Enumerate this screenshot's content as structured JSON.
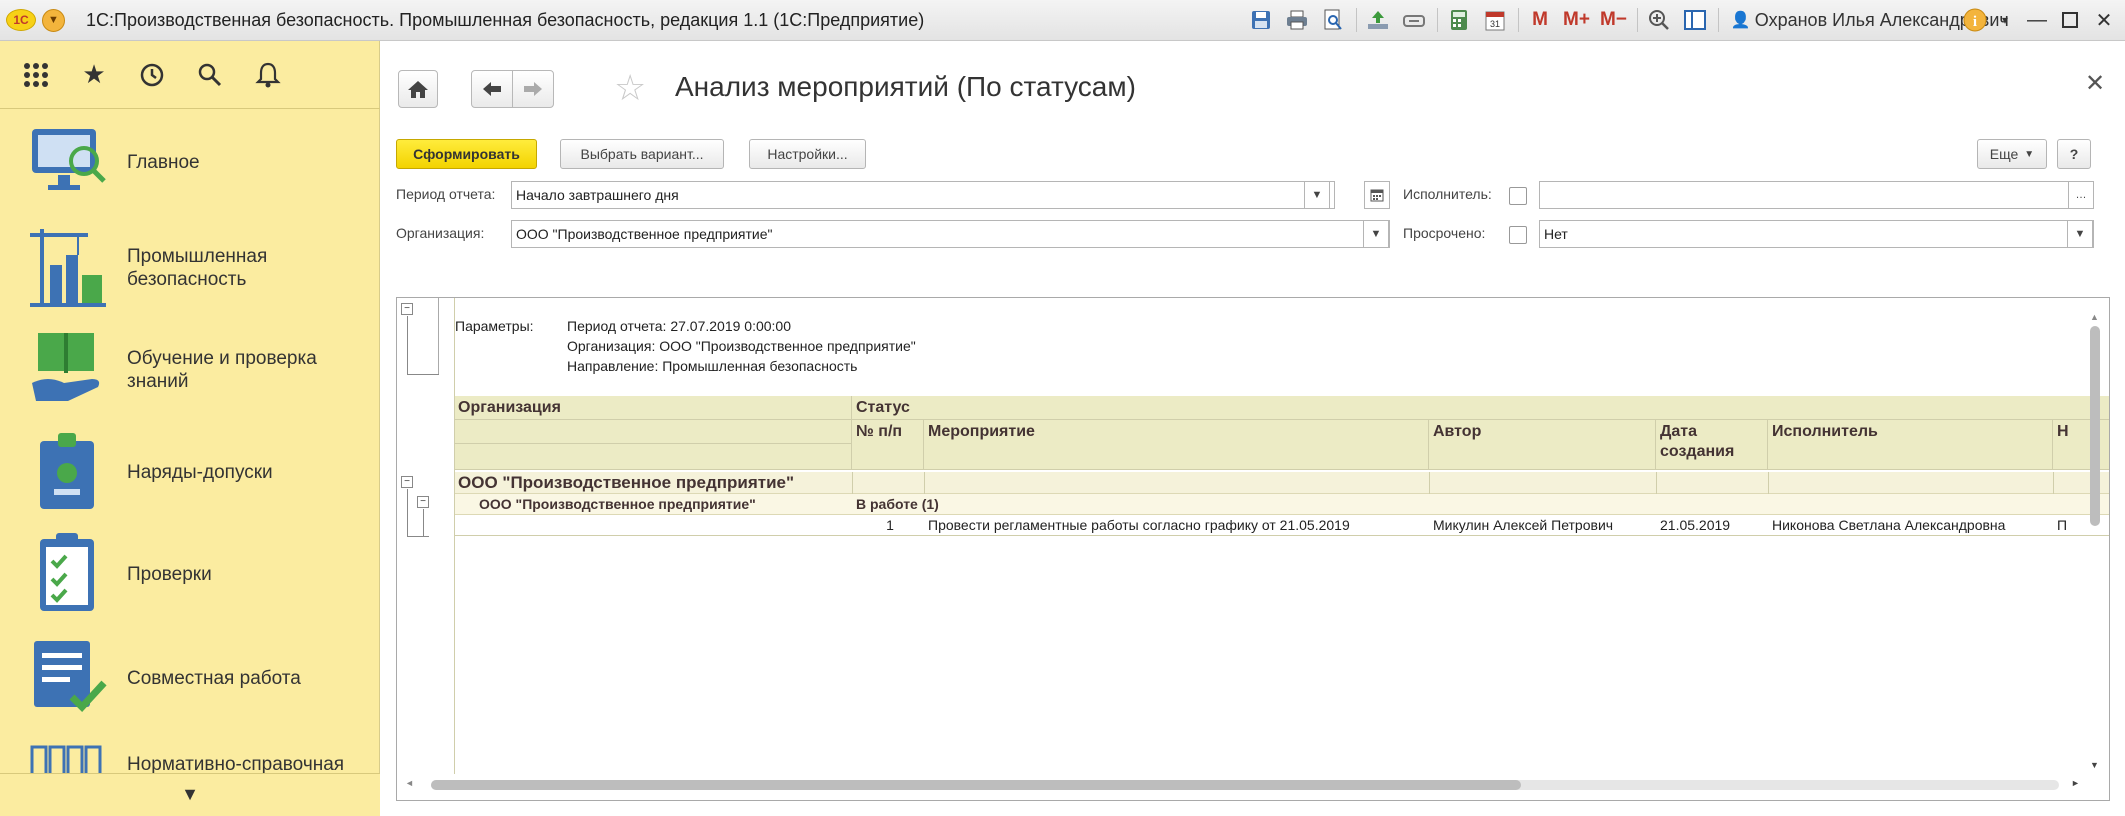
{
  "app": {
    "logo": "1С",
    "title": "1С:Производственная безопасность. Промышленная безопасность, редакция 1.1  (1С:Предприятие)",
    "user": "Охранов Илья Александрович",
    "toolbar_icons": [
      "save-icon",
      "print-icon",
      "print-preview-icon",
      "upload-icon",
      "link-icon",
      "calculator-icon",
      "calendar-icon"
    ],
    "memory_buttons": [
      "M",
      "M+",
      "M−"
    ]
  },
  "sidebar": {
    "items": [
      {
        "label": "Главное"
      },
      {
        "label": "Промышленная безопасность"
      },
      {
        "label": "Обучение и проверка знаний"
      },
      {
        "label": "Наряды-допуски"
      },
      {
        "label": "Проверки"
      },
      {
        "label": "Совместная работа"
      },
      {
        "label": "Нормативно-справочная"
      }
    ]
  },
  "form": {
    "title": "Анализ мероприятий (По статусам)",
    "generate_button": "Сформировать",
    "choose_variant_button": "Выбрать вариант...",
    "settings_button": "Настройки...",
    "more_button": "Еще",
    "help_button": "?",
    "period_label": "Период отчета:",
    "period_value": "Начало завтрашнего дня",
    "org_label": "Организация:",
    "org_value": "ООО \"Производственное предприятие\"",
    "executor_label": "Исполнитель:",
    "executor_value": "",
    "overdue_label": "Просрочено:",
    "overdue_value": "Нет"
  },
  "report": {
    "params_label": "Параметры:",
    "params": [
      "Период отчета: 27.07.2019 0:00:00",
      "Организация: ООО \"Производственное предприятие\"",
      "Направление: Промышленная безопасность"
    ],
    "header_org": "Организация",
    "header_status": "Статус",
    "columns": [
      "№ п/п",
      "Мероприятие",
      "Автор",
      "Дата создания",
      "Исполнитель",
      "Н"
    ],
    "group_org": "ООО \"Производственное предприятие\"",
    "subgroup_org": "ООО \"Производственное предприятие\"",
    "subgroup_status": "В работе (1)",
    "rows": [
      {
        "num": "1",
        "event": "Провести регламентные работы согласно графику от 21.05.2019",
        "author": "Микулин Алексей Петрович",
        "date": "21.05.2019",
        "executor": "Никонова Светлана Александровна",
        "extra": "П"
      }
    ]
  }
}
